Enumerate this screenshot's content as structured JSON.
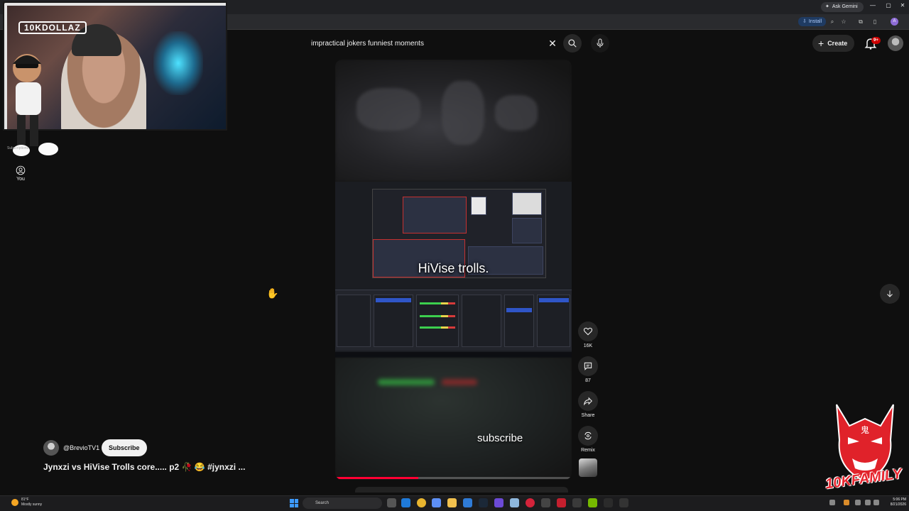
{
  "browser": {
    "gemini_label": "Ask Gemini",
    "install_label": "Install",
    "profile_letter": "A"
  },
  "youtube": {
    "search": {
      "value": "impractical jokers funniest moments",
      "placeholder": "Search"
    },
    "create_label": "Create",
    "notifications_badge": "9+",
    "sidebar": {
      "you_label": "You",
      "subscriptions_label": "Subscriptions"
    }
  },
  "webcam": {
    "label": "10KDOLLAZ"
  },
  "short": {
    "overlay_caption": "HiVise trolls.",
    "bottom_caption": "subscribe",
    "progress_fraction": 0.35,
    "channel_handle": "@BrevioTV1",
    "subscribe_label": "Subscribe",
    "title": "Jynxzi vs HiVise Trolls core..... p2 🥀 😂 #jynxzi ...",
    "actions": {
      "like_count": "16K",
      "comment_count": "87",
      "share_label": "Share",
      "remix_label": "Remix"
    }
  },
  "overlay_logo": {
    "text": "10KFAMILY"
  },
  "taskbar": {
    "weather_temp": "81°F",
    "weather_desc": "Mostly sunny",
    "search_label": "Search",
    "time": "5:06 PM",
    "date": "8/21/2026"
  },
  "colors": {
    "background": "#0f0f0f",
    "accent_red": "#ff0033",
    "install_chip": "#1f3b62"
  }
}
